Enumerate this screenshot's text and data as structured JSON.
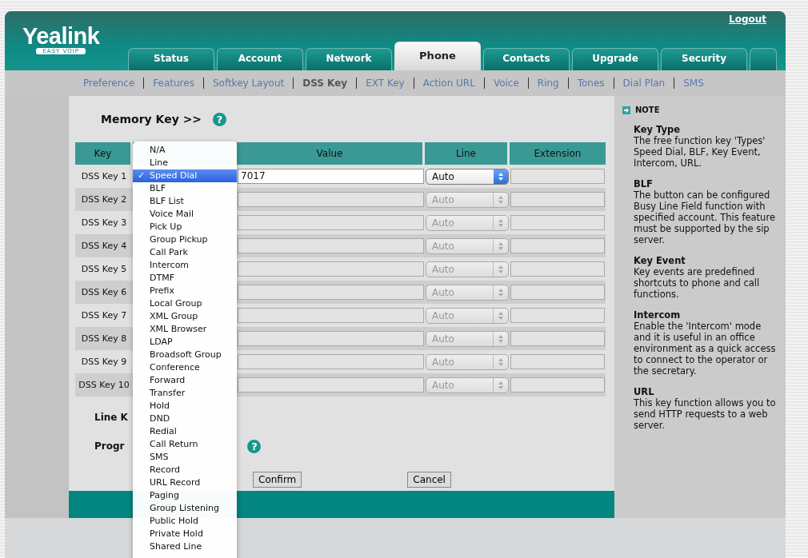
{
  "logo": {
    "name": "Yealink",
    "tagline": "EASY VOIP"
  },
  "logout": "Logout",
  "tabs": [
    {
      "label": "Status",
      "selected": false
    },
    {
      "label": "Account",
      "selected": false
    },
    {
      "label": "Network",
      "selected": false
    },
    {
      "label": "Phone",
      "selected": true
    },
    {
      "label": "Contacts",
      "selected": false
    },
    {
      "label": "Upgrade",
      "selected": false
    },
    {
      "label": "Security",
      "selected": false
    }
  ],
  "subnav": [
    {
      "label": "Preference",
      "selected": false
    },
    {
      "label": "Features",
      "selected": false
    },
    {
      "label": "Softkey Layout",
      "selected": false
    },
    {
      "label": "DSS Key",
      "selected": true
    },
    {
      "label": "EXT Key",
      "selected": false
    },
    {
      "label": "Action URL",
      "selected": false
    },
    {
      "label": "Voice",
      "selected": false
    },
    {
      "label": "Ring",
      "selected": false
    },
    {
      "label": "Tones",
      "selected": false
    },
    {
      "label": "Dial Plan",
      "selected": false
    },
    {
      "label": "SMS",
      "selected": false
    }
  ],
  "section_title": "Memory Key >>",
  "section_help": "?",
  "table": {
    "columns": [
      "Key",
      "Value",
      "Line",
      "Extension"
    ],
    "rows": [
      {
        "key": "DSS Key 1",
        "value": "7017",
        "line": "Auto",
        "disabled": false
      },
      {
        "key": "DSS Key 2",
        "line": "Auto",
        "disabled": true
      },
      {
        "key": "DSS Key 3",
        "line": "Auto",
        "disabled": true
      },
      {
        "key": "DSS Key 4",
        "line": "Auto",
        "disabled": true
      },
      {
        "key": "DSS Key 5",
        "line": "Auto",
        "disabled": true
      },
      {
        "key": "DSS Key 6",
        "line": "Auto",
        "disabled": true
      },
      {
        "key": "DSS Key 7",
        "line": "Auto",
        "disabled": true
      },
      {
        "key": "DSS Key 8",
        "line": "Auto",
        "disabled": true
      },
      {
        "key": "DSS Key 9",
        "line": "Auto",
        "disabled": true
      },
      {
        "key": "DSS Key 10",
        "line": "Auto",
        "disabled": true
      }
    ]
  },
  "more_sections": [
    {
      "title": "Line K"
    },
    {
      "title": "Progr",
      "help": "?"
    }
  ],
  "buttons": [
    "Confirm",
    "Cancel"
  ],
  "type_menu_check": "✓",
  "type_menu": [
    {
      "label": "N/A",
      "selected": false
    },
    {
      "label": "Line",
      "selected": false
    },
    {
      "label": "Speed Dial",
      "selected": true
    },
    {
      "label": "BLF",
      "selected": false
    },
    {
      "label": "BLF List",
      "selected": false
    },
    {
      "label": "Voice Mail",
      "selected": false
    },
    {
      "label": "Pick Up",
      "selected": false
    },
    {
      "label": "Group Pickup",
      "selected": false
    },
    {
      "label": "Call Park",
      "selected": false
    },
    {
      "label": "Intercom",
      "selected": false
    },
    {
      "label": "DTMF",
      "selected": false
    },
    {
      "label": "Prefix",
      "selected": false
    },
    {
      "label": "Local Group",
      "selected": false
    },
    {
      "label": "XML Group",
      "selected": false
    },
    {
      "label": "XML Browser",
      "selected": false
    },
    {
      "label": "LDAP",
      "selected": false
    },
    {
      "label": "Broadsoft Group",
      "selected": false
    },
    {
      "label": "Conference",
      "selected": false
    },
    {
      "label": "Forward",
      "selected": false
    },
    {
      "label": "Transfer",
      "selected": false
    },
    {
      "label": "Hold",
      "selected": false
    },
    {
      "label": "DND",
      "selected": false
    },
    {
      "label": "Redial",
      "selected": false
    },
    {
      "label": "Call Return",
      "selected": false
    },
    {
      "label": "SMS",
      "selected": false
    },
    {
      "label": "Record",
      "selected": false
    },
    {
      "label": "URL Record",
      "selected": false
    },
    {
      "label": "Paging",
      "selected": false
    },
    {
      "label": "Group Listening",
      "selected": false
    },
    {
      "label": "Public Hold",
      "selected": false
    },
    {
      "label": "Private Hold",
      "selected": false
    },
    {
      "label": "Shared Line",
      "selected": false
    }
  ],
  "note": {
    "title": "NOTE",
    "items": [
      {
        "title": "Key Type",
        "text": "The free function key 'Types' Speed Dial, BLF, Key Event, Intercom, URL."
      },
      {
        "title": "BLF",
        "text": "The button can be configured Busy Line Field function with specified account. This feature must be supported by the sip server."
      },
      {
        "title": "Key Event",
        "text": "Key events are predefined shortcuts to phone and call functions."
      },
      {
        "title": "Intercom",
        "text": "Enable the 'Intercom' mode and it is useful in an office environment as a quick access to connect to the operator or the secretary."
      },
      {
        "title": "URL",
        "text": "This key function allows you to send HTTP requests to a web server."
      }
    ]
  }
}
